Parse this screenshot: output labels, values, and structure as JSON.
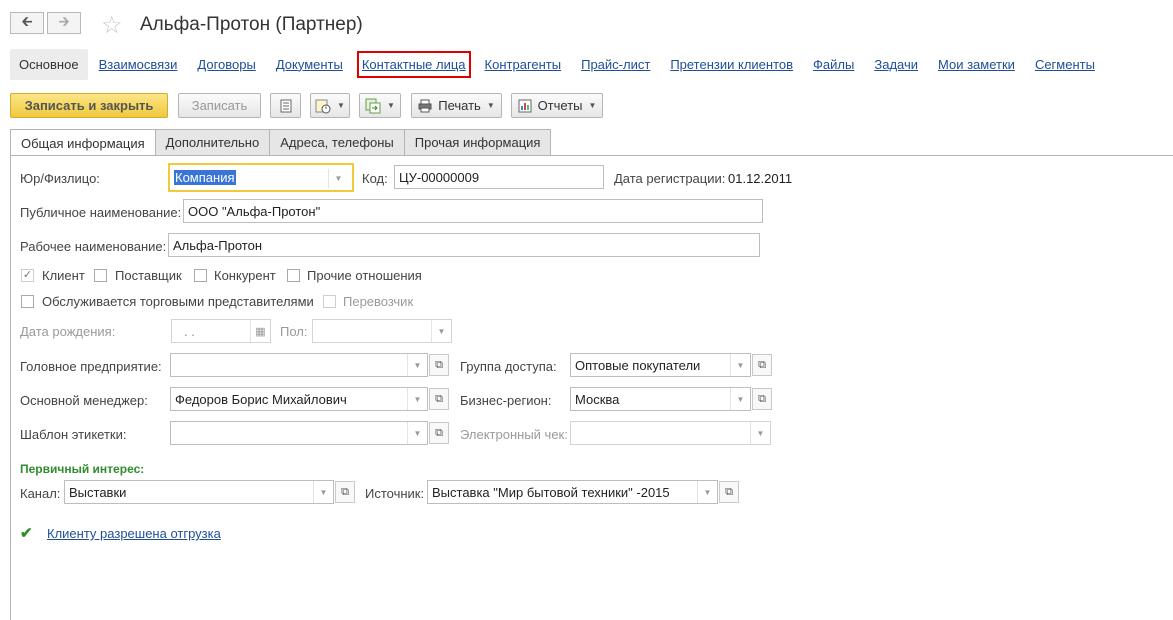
{
  "header": {
    "back_icon": "arrow-left-icon",
    "forward_icon": "arrow-right-icon",
    "favorite_icon": "star-icon",
    "title": "Альфа-Протон (Партнер)"
  },
  "nav": {
    "items": [
      {
        "label": "Основное",
        "state": "current"
      },
      {
        "label": "Взаимосвязи"
      },
      {
        "label": "Договоры"
      },
      {
        "label": "Документы"
      },
      {
        "label": "Контактные лица",
        "highlighted": true
      },
      {
        "label": "Контрагенты"
      },
      {
        "label": "Прайс-лист"
      },
      {
        "label": "Претензии клиентов"
      },
      {
        "label": "Файлы"
      },
      {
        "label": "Задачи"
      },
      {
        "label": "Мои заметки"
      },
      {
        "label": "Сегменты"
      }
    ],
    "highlight_color": "#e00000"
  },
  "toolbar": {
    "save_close_label": "Записать и закрыть",
    "save_label": "Записать",
    "print_label": "Печать",
    "reports_label": "Отчеты",
    "icons": [
      "list-icon",
      "history-icon",
      "create-based-on-icon",
      "printer-icon",
      "reports-icon"
    ],
    "primary_color": "#f0c93d"
  },
  "tabs": [
    {
      "label": "Общая информация",
      "active": true
    },
    {
      "label": "Дополнительно"
    },
    {
      "label": "Адреса, телефоны"
    },
    {
      "label": "Прочая информация"
    }
  ],
  "form": {
    "kind_label": "Юр/Физлицо:",
    "kind_value": "Компания",
    "code_label": "Код:",
    "code_value": "ЦУ-00000009",
    "reg_date_label": "Дата регистрации:",
    "reg_date_value": "01.12.2011",
    "public_name_label": "Публичное наименование:",
    "public_name_value": "ООО \"Альфа-Протон\"",
    "work_name_label": "Рабочее наименование:",
    "work_name_value": "Альфа-Протон",
    "checkboxes": {
      "client": {
        "label": "Клиент",
        "checked": true
      },
      "supplier": {
        "label": "Поставщик",
        "checked": false
      },
      "competitor": {
        "label": "Конкурент",
        "checked": false
      },
      "other": {
        "label": "Прочие отношения",
        "checked": false
      },
      "served_by_reps": {
        "label": "Обслуживается торговыми представителями",
        "checked": false
      },
      "carrier": {
        "label": "Перевозчик",
        "checked": false
      }
    },
    "birth_date_label": "Дата рождения:",
    "birth_date_value": " .  .",
    "gender_label": "Пол:",
    "gender_value": "",
    "head_company_label": "Головное предприятие:",
    "head_company_value": "",
    "access_group_label": "Группа доступа:",
    "access_group_value": "Оптовые покупатели",
    "manager_label": "Основной менеджер:",
    "manager_value": "Федоров Борис Михайлович",
    "region_label": "Бизнес-регион:",
    "region_value": "Москва",
    "label_template_label": "Шаблон этикетки:",
    "label_template_value": "",
    "e_receipt_label": "Электронный чек:",
    "e_receipt_value": "",
    "primary_interest_header": "Первичный интерес:",
    "channel_label": "Канал:",
    "channel_value": "Выставки",
    "source_label": "Источник:",
    "source_value": "Выставка \"Мир бытовой техники\" -2015",
    "shipment_link": "Клиенту разрешена отгрузка",
    "shipment_icon": "checkmark-icon",
    "accent_green": "#2f8d2f"
  }
}
